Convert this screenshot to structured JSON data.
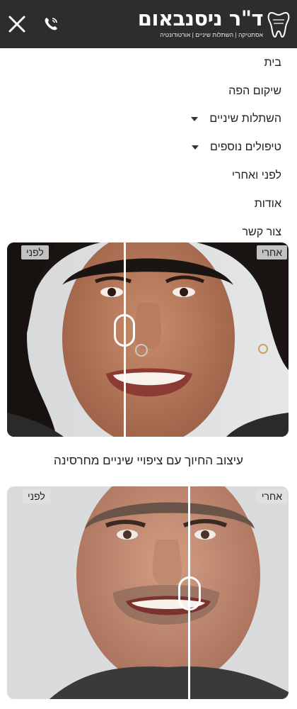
{
  "header": {
    "logo_title": "ד\"ר ניסנבאום",
    "logo_subtitle": "אסתטיקה | השתלות שיניים | אורטודונטיה",
    "close_icon": "close-icon",
    "phone_icon": "phone-icon",
    "colors": {
      "bar": "#2d2d2d",
      "text": "#ffffff"
    }
  },
  "menu": {
    "items": [
      {
        "label": "בית",
        "has_dropdown": false
      },
      {
        "label": "שיקום הפה",
        "has_dropdown": false
      },
      {
        "label": "השתלות שיניים",
        "has_dropdown": true
      },
      {
        "label": "טיפולים נוספים",
        "has_dropdown": true
      },
      {
        "label": "לפני ואחרי",
        "has_dropdown": false
      },
      {
        "label": "אודות",
        "has_dropdown": false
      },
      {
        "label": "צור קשר",
        "has_dropdown": false
      }
    ]
  },
  "comparisons": [
    {
      "before_label": "לפני",
      "after_label": "אחרי"
    },
    {
      "before_label": "לפני",
      "after_label": "אחרי"
    }
  ],
  "caption": "עיצוב החיוך עם ציפויי שיניים מחרסינה"
}
